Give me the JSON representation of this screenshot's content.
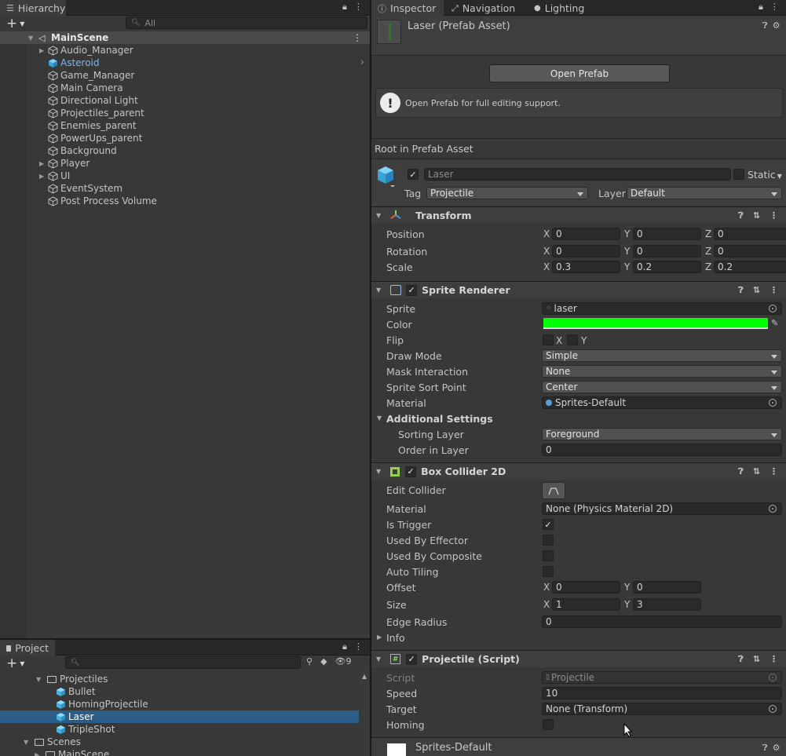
{
  "hierarchy": {
    "tab_label": "Hierarchy",
    "search_placeholder": "All",
    "scene_name": "MainScene",
    "items": [
      {
        "label": "Audio_Manager",
        "expandable": true,
        "selected": false
      },
      {
        "label": "Asteroid",
        "expandable": false,
        "selected": true
      },
      {
        "label": "Game_Manager",
        "expandable": false,
        "selected": false
      },
      {
        "label": "Main Camera",
        "expandable": false,
        "selected": false
      },
      {
        "label": "Directional Light",
        "expandable": false,
        "selected": false
      },
      {
        "label": "Projectiles_parent",
        "expandable": false,
        "selected": false
      },
      {
        "label": "Enemies_parent",
        "expandable": false,
        "selected": false
      },
      {
        "label": "PowerUps_parent",
        "expandable": false,
        "selected": false
      },
      {
        "label": "Background",
        "expandable": false,
        "selected": false
      },
      {
        "label": "Player",
        "expandable": true,
        "selected": false
      },
      {
        "label": "UI",
        "expandable": true,
        "selected": false
      },
      {
        "label": "EventSystem",
        "expandable": false,
        "selected": false
      },
      {
        "label": "Post Process Volume",
        "expandable": false,
        "selected": false
      }
    ]
  },
  "project": {
    "tab_label": "Project",
    "hidden_count": "9",
    "items": [
      {
        "label": "Projectiles",
        "type": "folder",
        "expanded": true,
        "selected": false
      },
      {
        "label": "Bullet",
        "type": "prefab",
        "selected": false
      },
      {
        "label": "HomingProjectile",
        "type": "prefab",
        "selected": false
      },
      {
        "label": "Laser",
        "type": "prefab",
        "selected": true
      },
      {
        "label": "TripleShot",
        "type": "prefab",
        "selected": false
      },
      {
        "label": "Scenes",
        "type": "folder",
        "expanded": true,
        "selected": false
      },
      {
        "label": "MainScene",
        "type": "folder",
        "expanded": false,
        "selected": false
      }
    ]
  },
  "inspector": {
    "tabs": [
      "Inspector",
      "Navigation",
      "Lighting"
    ],
    "asset_title": "Laser (Prefab Asset)",
    "open_prefab_label": "Open Prefab",
    "info_message": "Open Prefab for full editing support.",
    "root_label": "Root in Prefab Asset",
    "object_name": "Laser",
    "static_label": "Static",
    "tag_label": "Tag",
    "tag_value": "Projectile",
    "layer_label": "Layer",
    "layer_value": "Default",
    "transform": {
      "title": "Transform",
      "position": {
        "label": "Position",
        "x": "0",
        "y": "0",
        "z": "0"
      },
      "rotation": {
        "label": "Rotation",
        "x": "0",
        "y": "0",
        "z": "0"
      },
      "scale": {
        "label": "Scale",
        "x": "0.3",
        "y": "0.2",
        "z": "0.2"
      }
    },
    "sprite_renderer": {
      "title": "Sprite Renderer",
      "sprite_label": "Sprite",
      "sprite_value": "laser",
      "color_label": "Color",
      "color_value": "#00ff00",
      "flip_label": "Flip",
      "flip_x": "X",
      "flip_y": "Y",
      "draw_mode_label": "Draw Mode",
      "draw_mode_value": "Simple",
      "mask_label": "Mask Interaction",
      "mask_value": "None",
      "sort_point_label": "Sprite Sort Point",
      "sort_point_value": "Center",
      "material_label": "Material",
      "material_value": "Sprites-Default",
      "additional_label": "Additional Settings",
      "sorting_layer_label": "Sorting Layer",
      "sorting_layer_value": "Foreground",
      "order_label": "Order in Layer",
      "order_value": "0"
    },
    "box_collider": {
      "title": "Box Collider 2D",
      "edit_label": "Edit Collider",
      "material_label": "Material",
      "material_value": "None (Physics Material 2D)",
      "is_trigger_label": "Is Trigger",
      "is_trigger": true,
      "effector_label": "Used By Effector",
      "composite_label": "Used By Composite",
      "tiling_label": "Auto Tiling",
      "offset_label": "Offset",
      "offset_x": "0",
      "offset_y": "0",
      "size_label": "Size",
      "size_x": "1",
      "size_y": "3",
      "edge_label": "Edge Radius",
      "edge_value": "0",
      "info_label": "Info"
    },
    "projectile": {
      "title": "Projectile (Script)",
      "script_label": "Script",
      "script_value": "Projectile",
      "speed_label": "Speed",
      "speed_value": "10",
      "target_label": "Target",
      "target_value": "None (Transform)",
      "homing_label": "Homing"
    },
    "material_footer": "Sprites-Default"
  }
}
